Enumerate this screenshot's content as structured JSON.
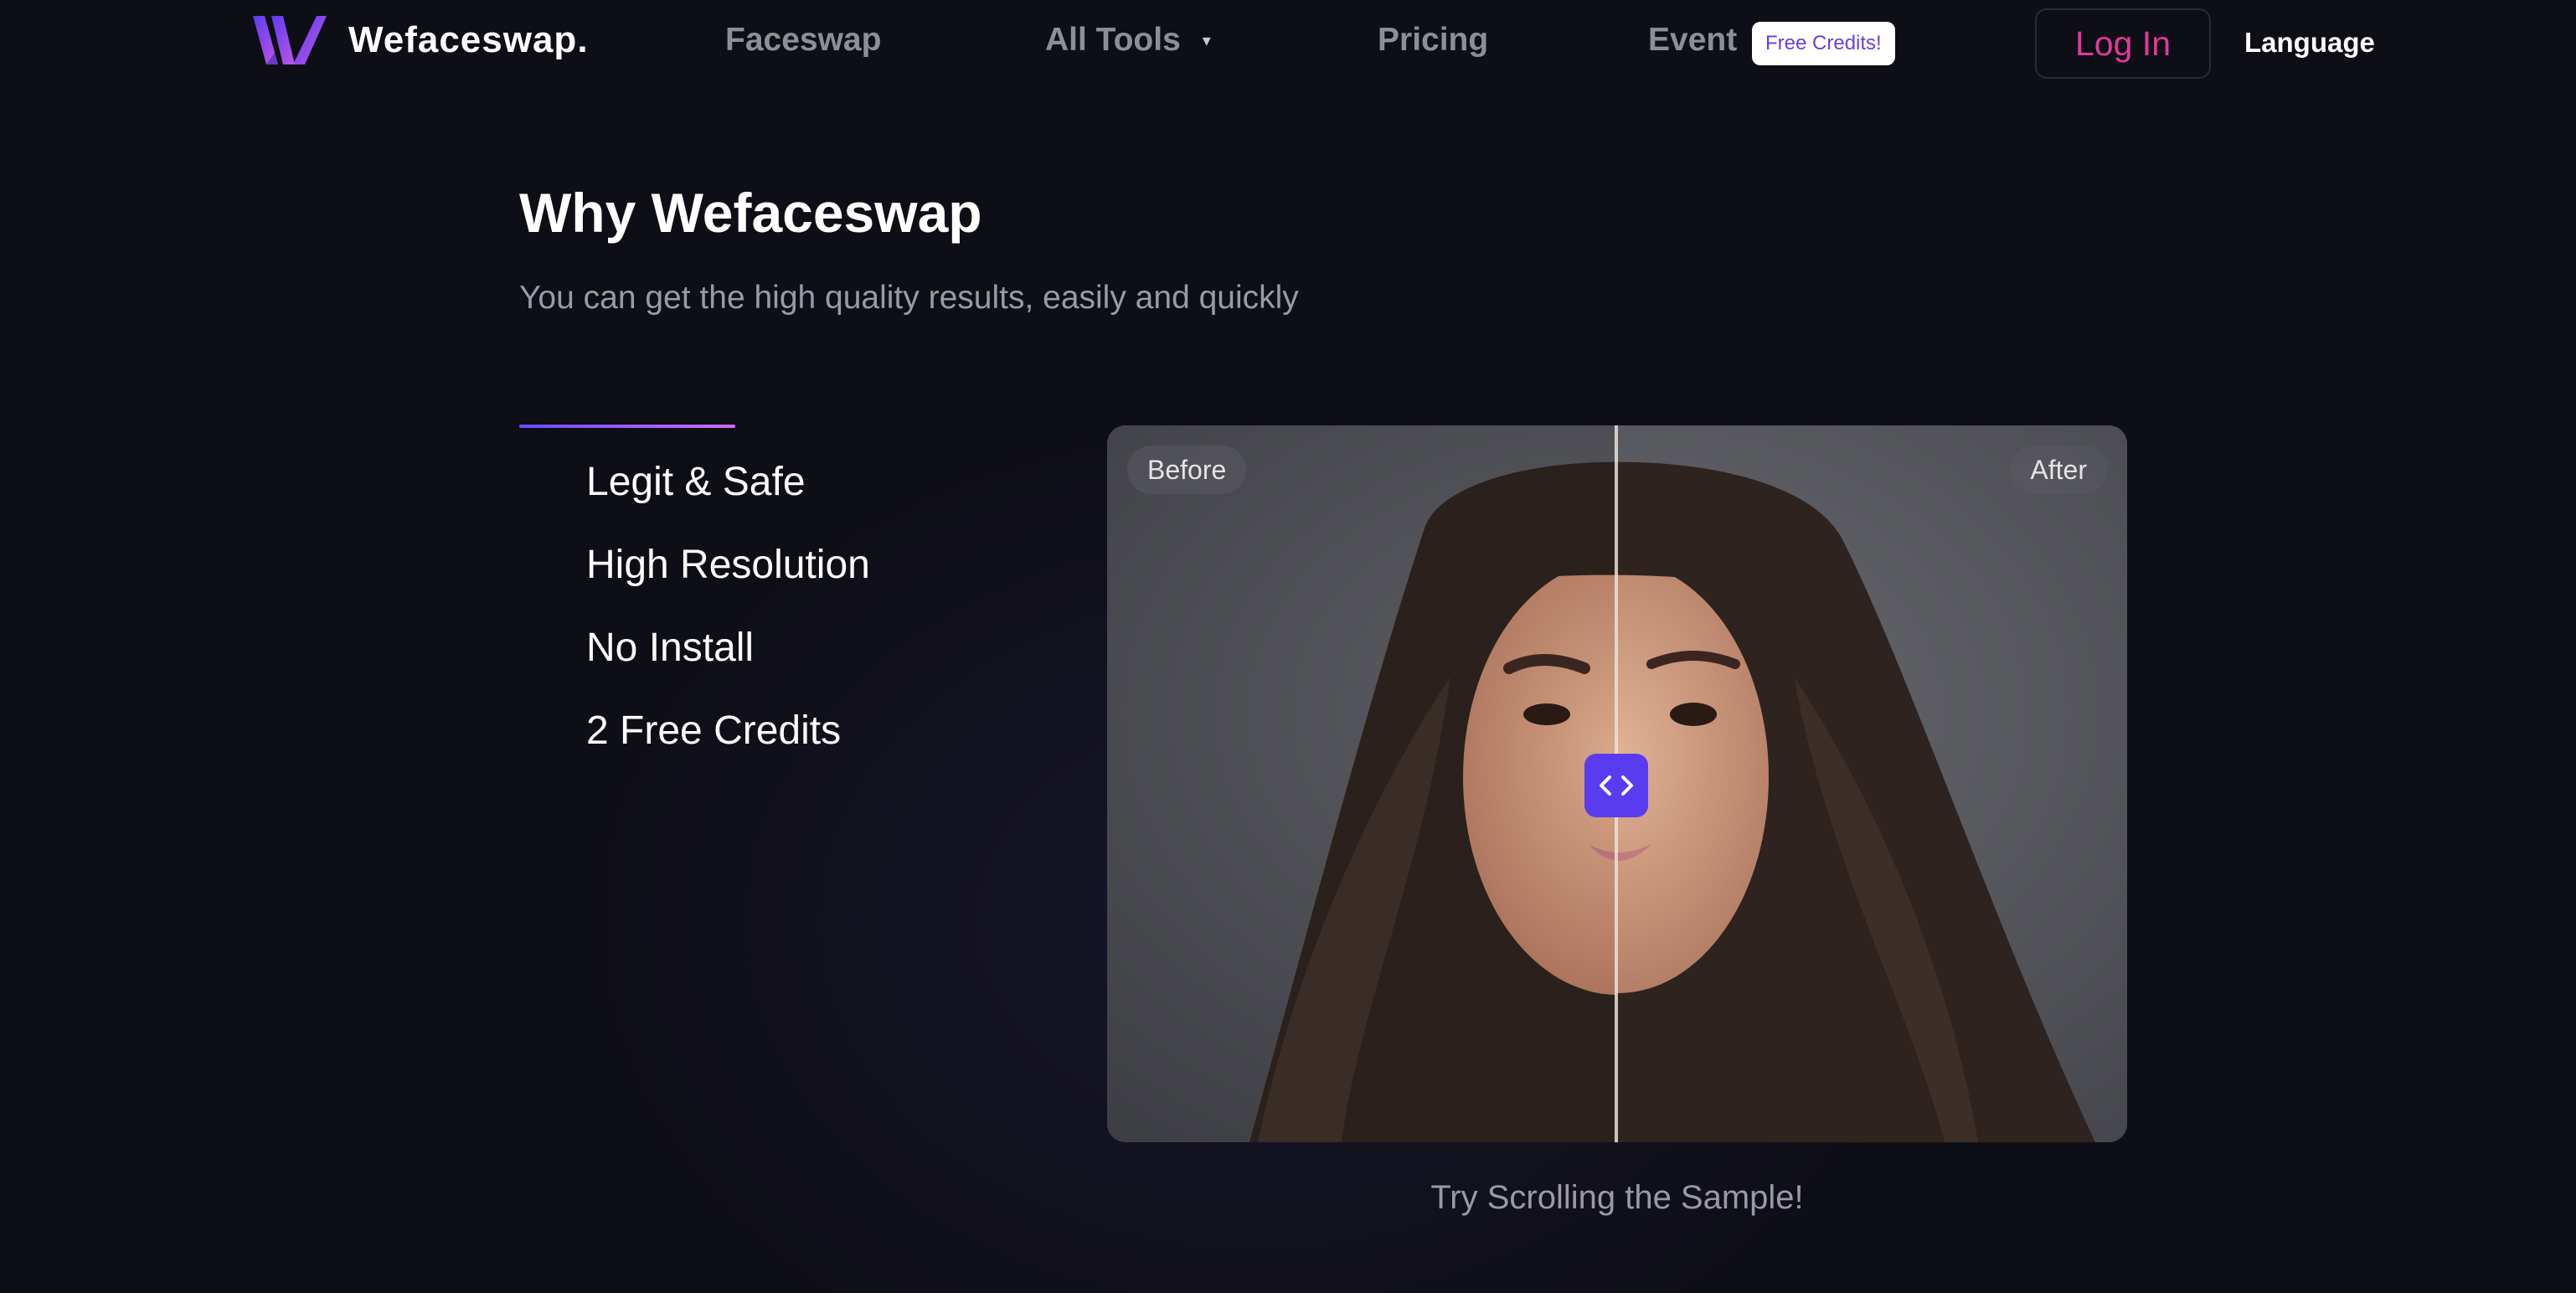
{
  "nav": {
    "brand": "Wefaceswap.",
    "links": {
      "faceswap": "Faceswap",
      "all_tools": "All Tools",
      "pricing": "Pricing",
      "event": "Event"
    },
    "event_badge": "Free Credits!",
    "login": "Log In",
    "language": "Language",
    "accent_color": "#e0399b",
    "badge_text_color": "#6b3fd6"
  },
  "hero": {
    "title": "Why Wefaceswap",
    "subtitle": "You can get the high quality results, easily and quickly"
  },
  "features": [
    "Legit & Safe",
    "High Resolution",
    "No Install",
    "2 Free Credits"
  ],
  "compare": {
    "before_label": "Before",
    "after_label": "After",
    "handle_icon": "left-right-arrows-icon",
    "handle_color": "#5a3cf0",
    "hint": "Try Scrolling the Sample!"
  }
}
